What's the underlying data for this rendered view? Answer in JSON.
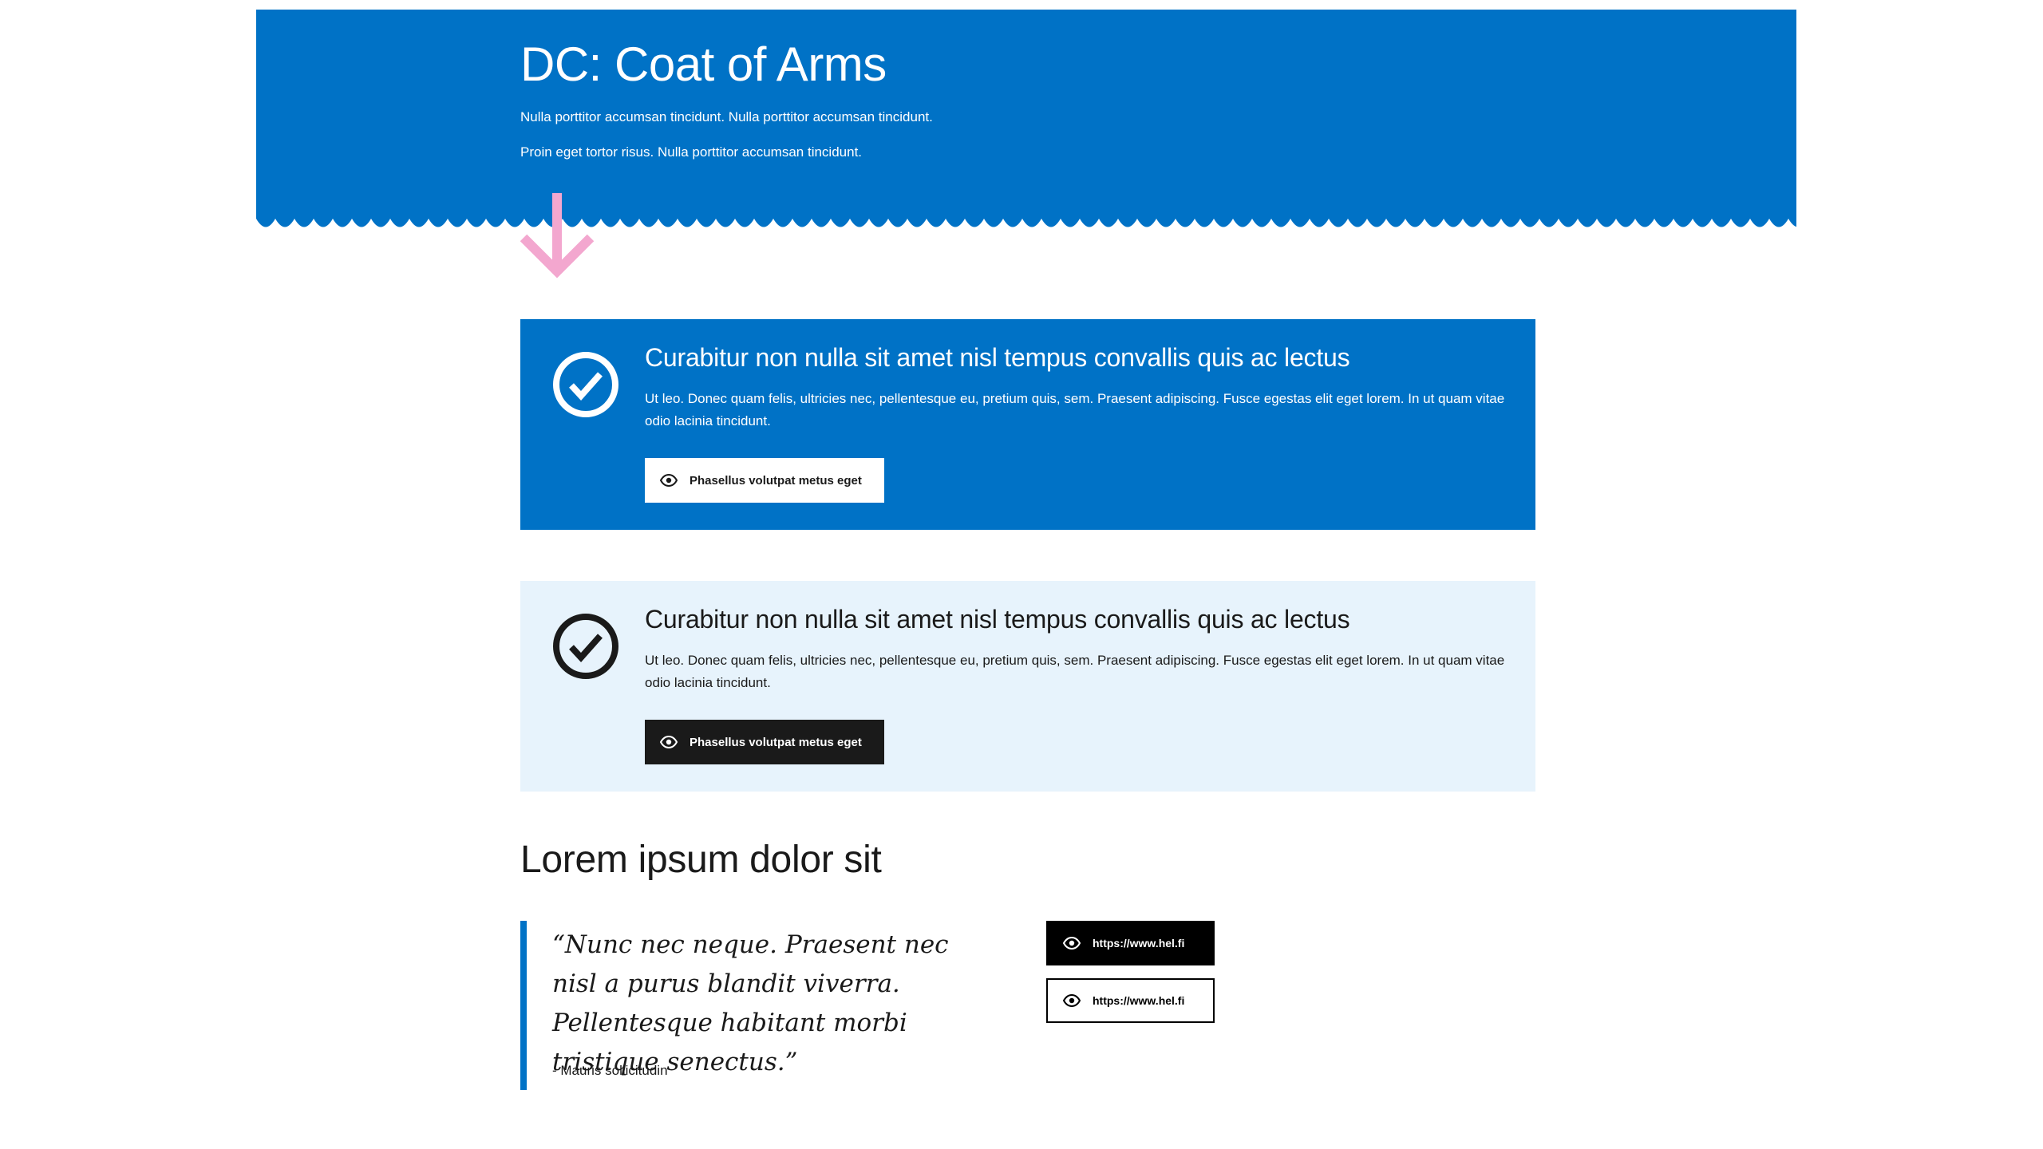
{
  "hero": {
    "title": "DC: Coat of Arms",
    "lines": [
      "Nulla porttitor accumsan tincidunt. Nulla porttitor accumsan tincidunt.",
      "Proin eget tortor risus. Nulla porttitor accumsan tincidunt."
    ],
    "background_color": "#0072c6",
    "arrow_icon": "arrow-down-icon",
    "arrow_color": "#f3a7cf"
  },
  "cards": [
    {
      "variant": "primary",
      "icon": "check-circle-icon",
      "title": "Curabitur non nulla sit amet nisl tempus convallis quis ac lectus",
      "body": "Ut leo. Donec quam felis, ultricies nec, pellentesque eu, pretium quis, sem. Praesent adipiscing. Fusce egestas elit eget lorem. In ut quam vitae odio lacinia tincidunt.",
      "action_label": "Phasellus volutpat metus eget",
      "action_icon": "eye-icon",
      "background_color": "#0072c6"
    },
    {
      "variant": "light",
      "icon": "check-circle-icon",
      "title": "Curabitur non nulla sit amet nisl tempus convallis quis ac lectus",
      "body": "Ut leo. Donec quam felis, ultricies nec, pellentesque eu, pretium quis, sem. Praesent adipiscing. Fusce egestas elit eget lorem. In ut quam vitae odio lacinia tincidunt.",
      "action_label": "Phasellus volutpat metus eget",
      "action_icon": "eye-icon",
      "background_color": "#e7f3fc"
    }
  ],
  "section": {
    "heading": "Lorem ipsum dolor sit",
    "quote": {
      "text": "“Nunc nec neque. Praesent nec nisl a purus blandit viverra. Pellentesque habitant morbi tristique senectus.”",
      "author": "- Mauris sollicitudin",
      "accent_color": "#0072c6"
    },
    "links": [
      {
        "label": "https://www.hel.fi",
        "style": "filled",
        "icon": "eye-icon"
      },
      {
        "label": "https://www.hel.fi",
        "style": "outline",
        "icon": "eye-icon"
      }
    ]
  }
}
